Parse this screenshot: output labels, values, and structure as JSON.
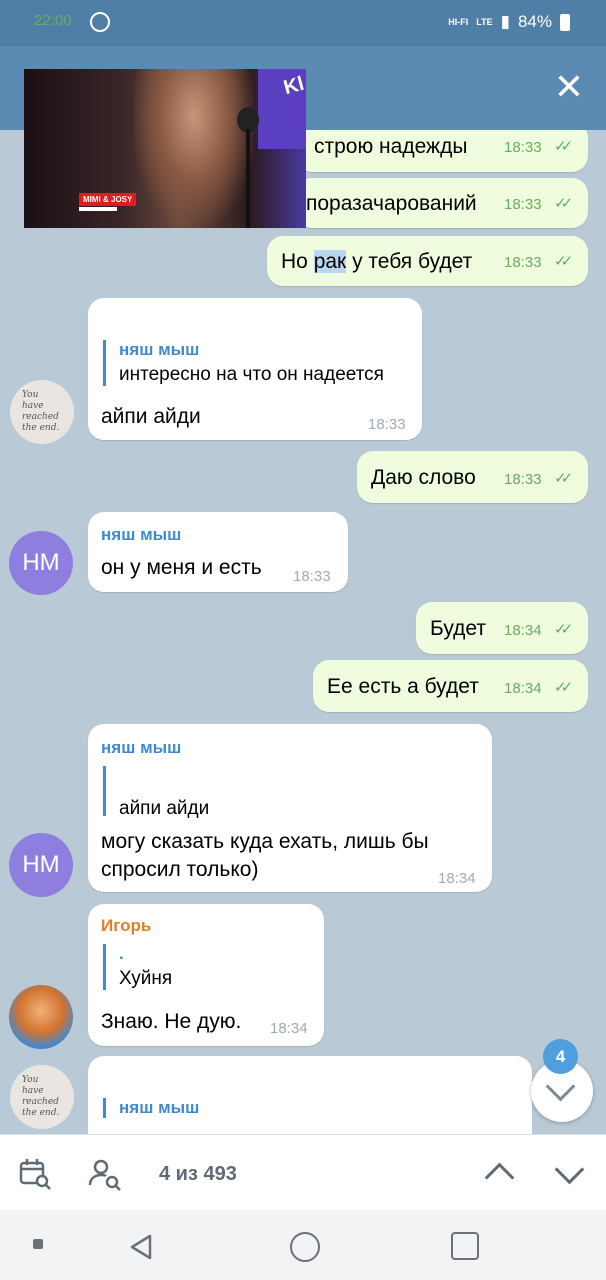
{
  "status_bar": {
    "time": "22:00",
    "net_top": "HI-FI",
    "lte": "LTE",
    "battery": "84%"
  },
  "video": {
    "tag": "MIMI & JOSY",
    "logo": "Kl"
  },
  "messages": [
    {
      "text": "строю надежды",
      "time": "18:33"
    },
    {
      "text": "поразачарований",
      "time": "18:33"
    },
    {
      "text_before": "Но ",
      "highlight": "рак",
      "text_after": " у тебя будет",
      "time": "18:33"
    },
    {
      "reply_name": "няш мыш",
      "reply_text": "интересно на что он надеется",
      "text": "айпи айди",
      "time": "18:33"
    },
    {
      "text": "Даю слово",
      "time": "18:33"
    },
    {
      "sender": "няш мыш",
      "text": "он у меня и есть",
      "time": "18:33",
      "avatar": "НМ"
    },
    {
      "text": "Будет",
      "time": "18:34"
    },
    {
      "text": "Ее есть а будет",
      "time": "18:34"
    },
    {
      "sender": "няш мыш",
      "reply_text": "айпи айди",
      "text_line1": "могу сказать куда ехать, лишь бы",
      "text_line2": "спросил только)",
      "time": "18:34",
      "avatar": "НМ"
    },
    {
      "sender": "Игорь",
      "reply_name": ".",
      "reply_text": "Хуйня",
      "text": "Знаю. Не дую.",
      "time": "18:34"
    },
    {
      "reply_name": "няш мыш"
    }
  ],
  "end_avatar_text": "You have reached the end.",
  "fab": {
    "badge": "4"
  },
  "search_bar": {
    "counter": "4 из 493"
  },
  "colors": {
    "header": "#5b8ab2",
    "status": "#4f7fa6",
    "outgoing": "#effdde",
    "accent": "#3f8ad0"
  }
}
